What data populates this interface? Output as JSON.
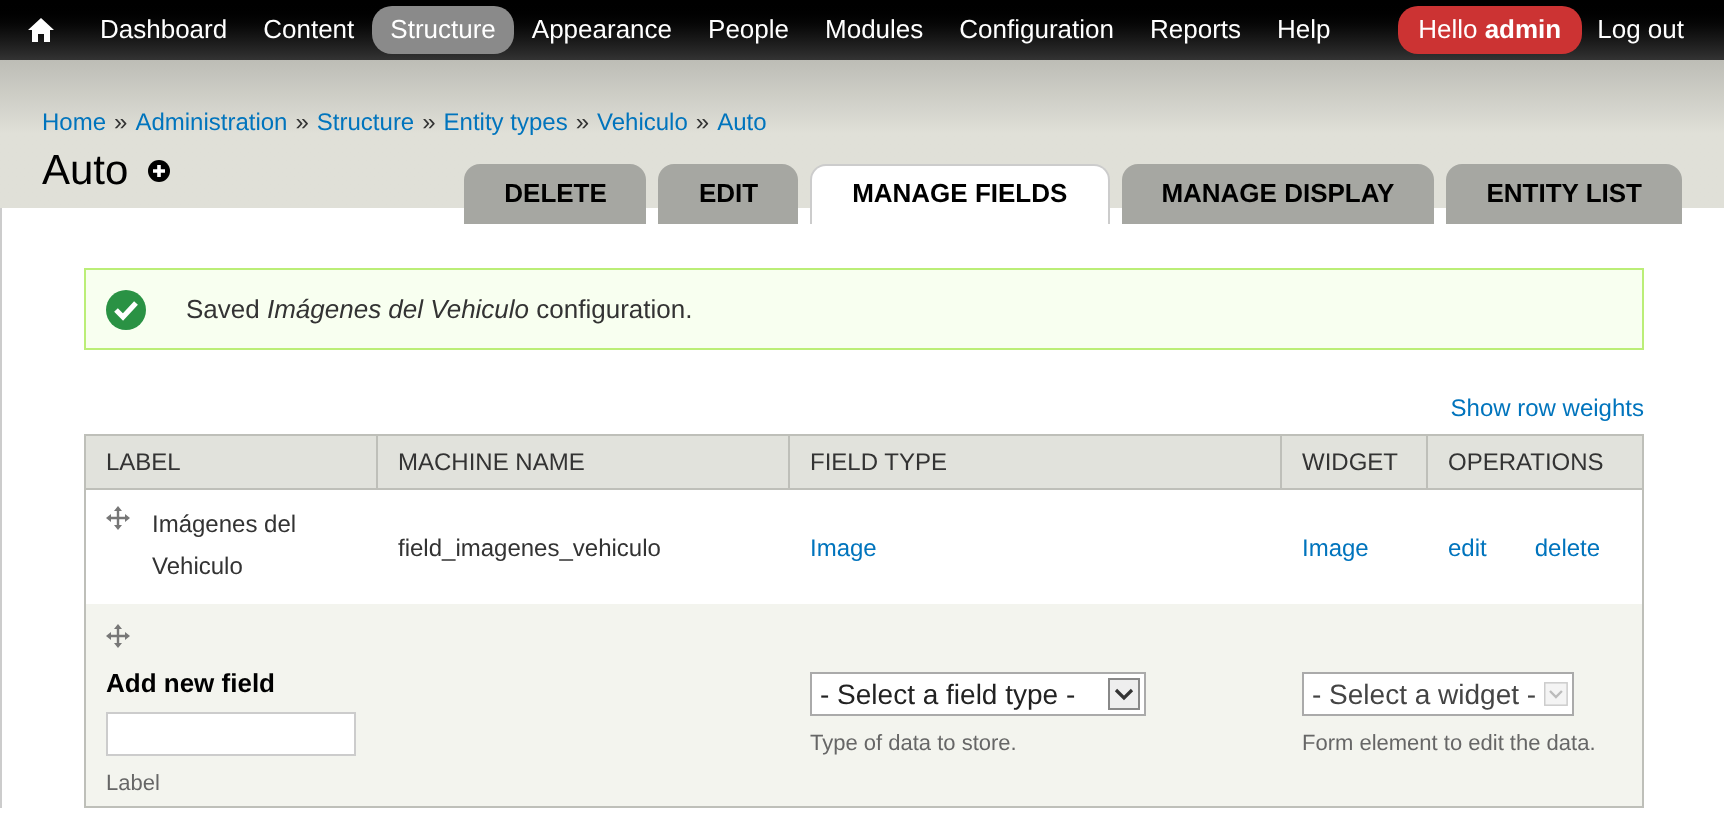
{
  "toolbar": {
    "items": [
      {
        "label": "Dashboard",
        "selected": false
      },
      {
        "label": "Content",
        "selected": false
      },
      {
        "label": "Structure",
        "selected": true
      },
      {
        "label": "Appearance",
        "selected": false
      },
      {
        "label": "People",
        "selected": false
      },
      {
        "label": "Modules",
        "selected": false
      },
      {
        "label": "Configuration",
        "selected": false
      },
      {
        "label": "Reports",
        "selected": false
      },
      {
        "label": "Help",
        "selected": false
      }
    ],
    "greeting": "Hello **admin**",
    "logout": "Log out"
  },
  "breadcrumb": [
    "Home",
    "Administration",
    "Structure",
    "Entity types",
    "Vehiculo",
    "Auto"
  ],
  "breadcrumb_separator": "»",
  "title": "Auto",
  "tabs": [
    {
      "label": "DELETE",
      "selected": false
    },
    {
      "label": "EDIT",
      "selected": false
    },
    {
      "label": "MANAGE FIELDS",
      "selected": true
    },
    {
      "label": "MANAGE DISPLAY",
      "selected": false
    },
    {
      "label": "ENTITY LIST",
      "selected": false
    }
  ],
  "message": "Saved *Imágenes del Vehiculo* configuration.",
  "show_row_weights": "Show row weights",
  "table": {
    "columns": [
      "LABEL",
      "MACHINE NAME",
      "FIELD TYPE",
      "WIDGET",
      "OPERATIONS"
    ],
    "rows": [
      {
        "label": "Imágenes del Vehiculo",
        "machine_name": "field_imagenes_vehiculo",
        "field_type": "Image",
        "widget": "Image",
        "operations": [
          "edit",
          "delete"
        ]
      }
    ],
    "add_row": {
      "heading": "Add new field",
      "label_hint": "Label",
      "field_type": {
        "value": "- Select a field type -",
        "disabled": false
      },
      "field_type_hint": "Type of data to store.",
      "widget": {
        "value": "- Select a widget -",
        "disabled": true
      },
      "widget_hint": "Form element to edit the data."
    }
  }
}
